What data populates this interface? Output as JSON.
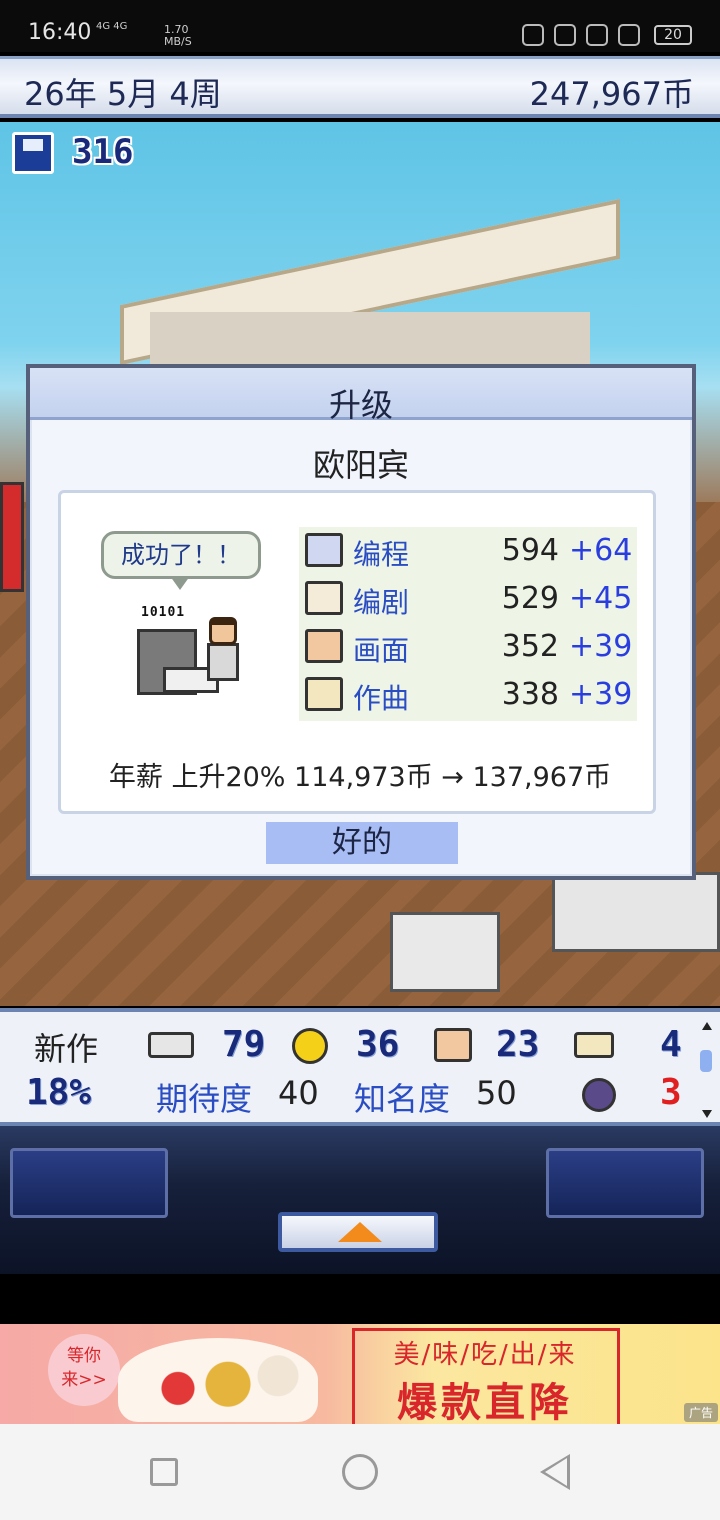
{
  "status_bar": {
    "time": "16:40",
    "network": "4G 4G",
    "speed_value": "1.70",
    "speed_unit": "MB/S",
    "battery": "20"
  },
  "top_bar": {
    "date": "26年 5月 4周",
    "money": "247,967币"
  },
  "save": {
    "count": "316"
  },
  "dialog": {
    "title": "升级",
    "employee_name": "欧阳宾",
    "speech": "成功了！！",
    "binary": "10101",
    "stats": [
      {
        "label": "编程",
        "value": "594",
        "increase": "+64",
        "icon": "computer-icon"
      },
      {
        "label": "编剧",
        "value": "529",
        "increase": "+45",
        "icon": "book-icon"
      },
      {
        "label": "画面",
        "value": "352",
        "increase": "+39",
        "icon": "palette-icon"
      },
      {
        "label": "作曲",
        "value": "338",
        "increase": "+39",
        "icon": "trumpet-icon"
      }
    ],
    "salary_text": "年薪 上升20% 114,973币 → 137,967币",
    "ok_label": "好的"
  },
  "info_bar": {
    "new_work_label": "新作",
    "progress": "18%",
    "fun_value": "79",
    "creativity_value": "36",
    "graphics_value": "23",
    "sound_value": "4",
    "bugs_value": "3",
    "expectation_label": "期待度",
    "expectation_value": "40",
    "fame_label": "知名度",
    "fame_value": "50"
  },
  "ad": {
    "badge_line1": "等你",
    "badge_line2": "来>>",
    "headline": "美/味/吃/出/来",
    "slogan": "爆款直降",
    "label": "广告"
  },
  "colors": {
    "accent_blue": "#2a3ee0",
    "dialog_bg": "#f2f6fc",
    "ok_button": "#a8bdf4",
    "ad_red": "#d8262b"
  }
}
